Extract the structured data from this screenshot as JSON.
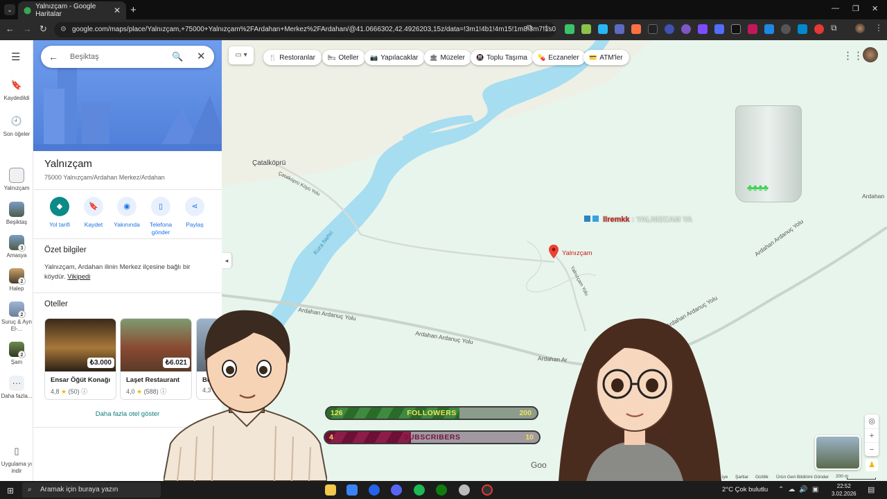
{
  "browser": {
    "tab_title": "Yalnızçam - Google Haritalar",
    "url": "google.com/maps/place/Yalnızçam,+75000+Yalnızçam%2FArdahan+Merkez%2FArdahan/@41.0666302,42.4926203,15z/data=!3m1!4b1!4m15!1m8!3m7!1s0..."
  },
  "rail": {
    "saved": "Kaydedildi",
    "recent": "Son öğeler",
    "items": [
      {
        "label": "Yalnızçam",
        "badge": ""
      },
      {
        "label": "Beşiktaş",
        "badge": ""
      },
      {
        "label": "Amasya",
        "badge": "3"
      },
      {
        "label": "Halep",
        "badge": "2"
      },
      {
        "label": "Suruç & Ayn El-...",
        "badge": "2"
      },
      {
        "label": "Şam",
        "badge": "2"
      },
      {
        "label": "Daha fazla...",
        "badge": ""
      }
    ],
    "app": "Uygulama yı indir"
  },
  "search": {
    "value": "Beşiktaş"
  },
  "place": {
    "title": "Yalnızçam",
    "address": "75000 Yalnızçam/Ardahan Merkez/Ardahan"
  },
  "actions": [
    {
      "label": "Yol tarifi",
      "icon": "directions-icon"
    },
    {
      "label": "Kaydet",
      "icon": "bookmark-icon"
    },
    {
      "label": "Yakınında",
      "icon": "nearby-icon"
    },
    {
      "label": "Telefona gönder",
      "icon": "phone-icon"
    },
    {
      "label": "Paylaş",
      "icon": "share-icon"
    }
  ],
  "summary": {
    "title": "Özet bilgiler",
    "text": "Yalnızçam, Ardahan ilinin Merkez ilçesine bağlı bir köydür.",
    "link": "Vikipedi"
  },
  "hotels": {
    "title": "Oteller",
    "items": [
      {
        "name": "Ensar Öğüt Konağı",
        "price": "₺3.000",
        "rating": "4,8",
        "reviews": "(50)"
      },
      {
        "name": "Laşet Restaurant",
        "price": "₺6.021",
        "rating": "4,0",
        "reviews": "(588)"
      },
      {
        "name": "Butik",
        "price": "",
        "rating": "4,3",
        "reviews": ""
      }
    ],
    "more": "Daha fazla otel göster"
  },
  "chips": [
    "Restoranlar",
    "Oteller",
    "Yapılacaklar",
    "Müzeler",
    "Toplu Taşıma",
    "Eczaneler",
    "ATM'ler"
  ],
  "map": {
    "town": "Çatalköprü",
    "pin_label": "Yalnızçam",
    "river": "Kura Nehri",
    "roads": [
      "Ardahan Ardanuç Yolu",
      "Ardahan Ardanuç Yolu",
      "Ardahan Ar",
      "Ardahan Ardanuç Yolu",
      "Ardahan Ardanuç Yolu",
      "Ardahan",
      "Çatalköprü Köyü Yolu",
      "Yalnızçam Yolu"
    ],
    "footer": [
      "Şartlar",
      "Gizlilik",
      "Ürün Geri Bildirimi Gönder"
    ],
    "footer_cut": "iye",
    "scale": "200 m",
    "google": "Goo"
  },
  "overlay": {
    "banner_user": "llremkk",
    "banner_text": ": YALNIZCAM YA",
    "followers": {
      "label": "FOLLOWERS",
      "current": "126",
      "goal": "200",
      "fraction": 0.63
    },
    "subscribers": {
      "label": "SUBSCRIBERS",
      "current": "4",
      "goal": "10",
      "fraction": 0.4
    }
  },
  "taskbar": {
    "search": "Aramak için buraya yazın",
    "weather_temp": "2°C",
    "weather_text": "Çok bulutlu",
    "time": "22:52",
    "date": "3.02.2026"
  },
  "colors": {
    "accent": "#0b8a88",
    "link": "#1a73e8",
    "river": "#a6ddf0"
  }
}
